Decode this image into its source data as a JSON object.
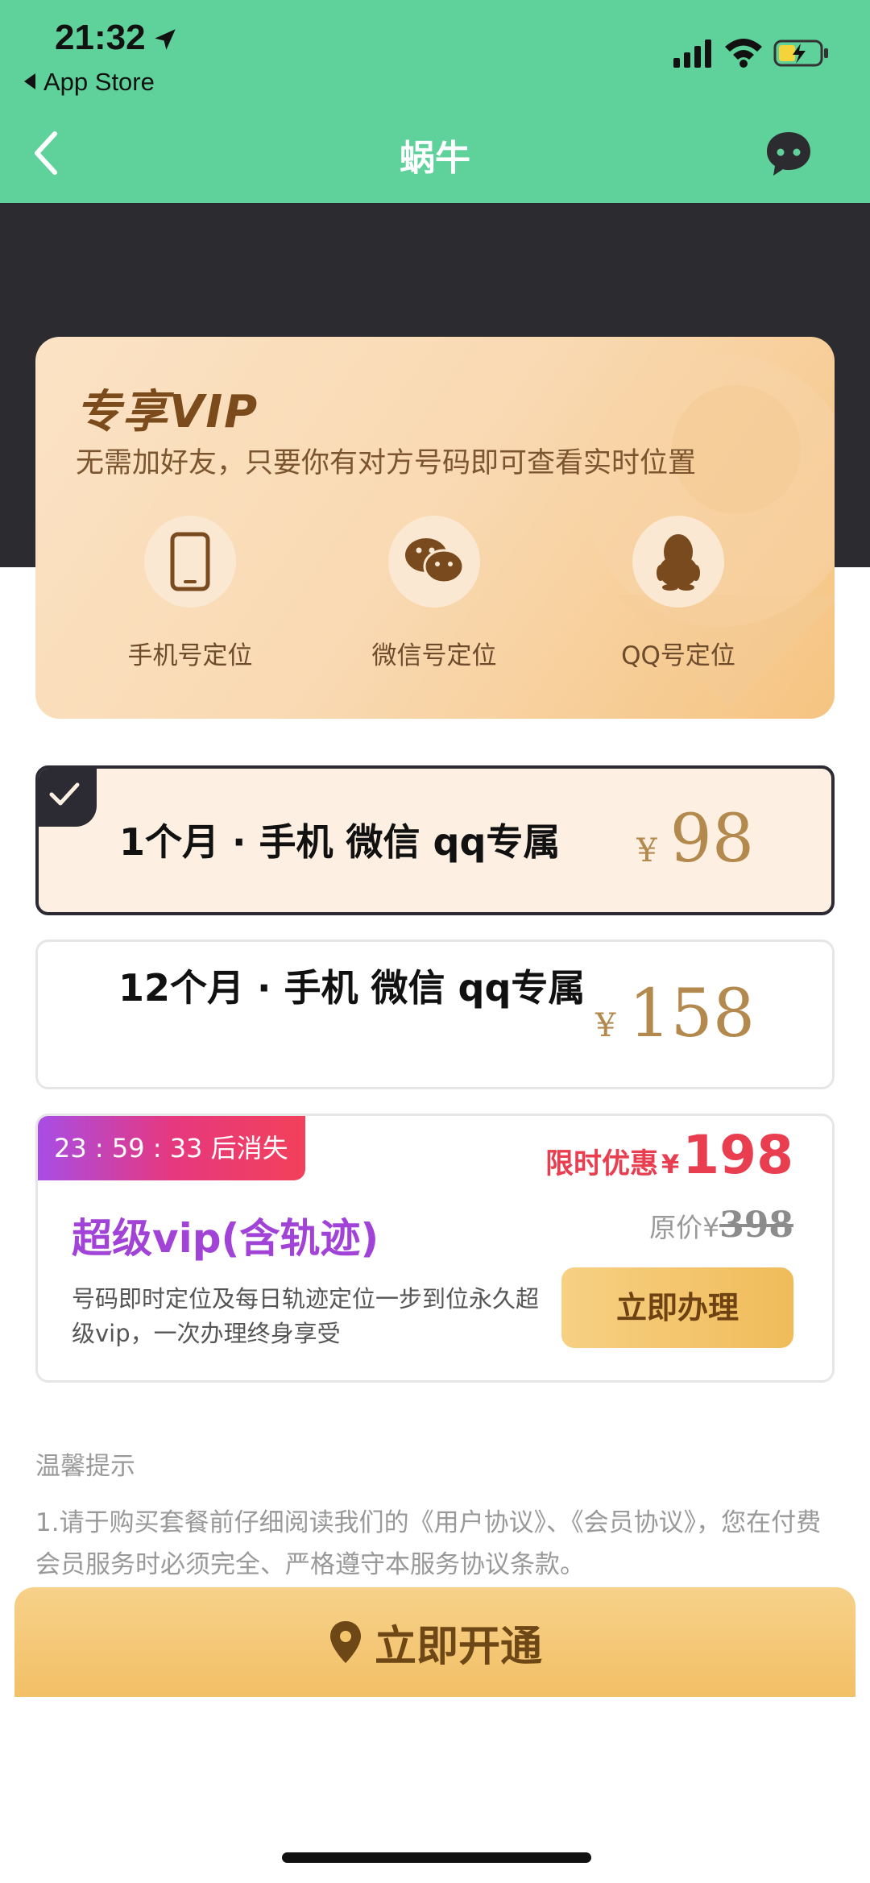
{
  "status_bar": {
    "time": "21:32",
    "back_app": "App Store"
  },
  "nav": {
    "title": "蜗牛"
  },
  "vip_card": {
    "title": "专享VIP",
    "subtitle": "无需加好友，只要你有对方号码即可查看实时位置",
    "features": [
      {
        "label": "手机号定位",
        "icon": "phone-icon"
      },
      {
        "label": "微信号定位",
        "icon": "wechat-icon"
      },
      {
        "label": "QQ号定位",
        "icon": "qq-penguin-icon"
      }
    ]
  },
  "plans": [
    {
      "name": "1个月 · 手机 微信 qq专属",
      "currency": "¥",
      "price": "98",
      "selected": true
    },
    {
      "name": "12个月 · 手机 微信 qq专属",
      "currency": "¥",
      "price": "158",
      "selected": false
    }
  ],
  "super_vip": {
    "countdown": "23 : 59 : 33 后消失",
    "title": "超级vip(含轨迹)",
    "promo_label": "限时优惠",
    "currency": "¥",
    "promo_price": "198",
    "original_label": "原价",
    "original_price": "398",
    "description": "号码即时定位及每日轨迹定位一步到位永久超级vip，一次办理终身享受",
    "button": "立即办理"
  },
  "tips": {
    "title": "温馨提示",
    "text": "1.请于购买套餐前仔细阅读我们的《用户协议》、《会员协议》，您在付费会员服务时必须完全、严格遵守本服务协议条款。"
  },
  "cta": {
    "label": "立即开通"
  },
  "colors": {
    "header": "#5fd19a",
    "gold": "#b3894d",
    "promo": "#e83e4f",
    "purple": "#a243d8",
    "dark": "#2c2b30"
  }
}
